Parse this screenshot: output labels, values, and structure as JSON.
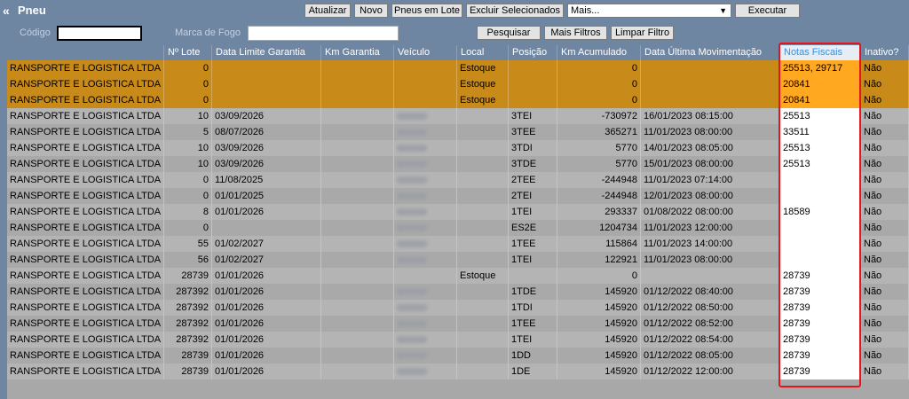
{
  "window": {
    "title": "Pneu"
  },
  "toolbar": {
    "atualizar": "Atualizar",
    "novo": "Novo",
    "pneus_em_lote": "Pneus em Lote",
    "excluir": "Excluir Selecionados",
    "mais_select": "Mais...",
    "executar": "Executar"
  },
  "filters": {
    "codigo_label": "Código",
    "codigo_value": "",
    "marca_label": "Marca de Fogo",
    "marca_value": "",
    "pesquisar": "Pesquisar",
    "mais_filtros": "Mais Filtros",
    "limpar_filtro": "Limpar Filtro"
  },
  "columns": [
    "Nº Lote",
    "Data Limite Garantia",
    "Km Garantia",
    "Veículo",
    "Local",
    "Posição",
    "Km Acumulado",
    "Data Última Movimentação",
    "Notas Fiscais",
    "Inativo?"
  ],
  "rows": [
    {
      "empresa": "RANSPORTE E LOGISTICA LTDA",
      "lote": "0",
      "data_lim": "",
      "km_gar": "",
      "veiculo": false,
      "local": "Estoque",
      "posicao": "",
      "km_acum": "0",
      "data_mov": "",
      "notas": "25513, 29717",
      "inativo": "Não",
      "selected": true
    },
    {
      "empresa": "RANSPORTE E LOGISTICA LTDA",
      "lote": "0",
      "data_lim": "",
      "km_gar": "",
      "veiculo": false,
      "local": "Estoque",
      "posicao": "",
      "km_acum": "0",
      "data_mov": "",
      "notas": "20841",
      "inativo": "Não",
      "selected": true
    },
    {
      "empresa": "RANSPORTE E LOGISTICA LTDA",
      "lote": "0",
      "data_lim": "",
      "km_gar": "",
      "veiculo": false,
      "local": "Estoque",
      "posicao": "",
      "km_acum": "0",
      "data_mov": "",
      "notas": "20841",
      "inativo": "Não",
      "selected": true
    },
    {
      "empresa": "RANSPORTE E LOGISTICA LTDA",
      "lote": "10",
      "data_lim": "03/09/2026",
      "km_gar": "",
      "veiculo": true,
      "local": "",
      "posicao": "3TEI",
      "km_acum": "-730972",
      "data_mov": "16/01/2023 08:15:00",
      "notas": "25513",
      "inativo": "Não",
      "selected": false
    },
    {
      "empresa": "RANSPORTE E LOGISTICA LTDA",
      "lote": "5",
      "data_lim": "08/07/2026",
      "km_gar": "",
      "veiculo": true,
      "local": "",
      "posicao": "3TEE",
      "km_acum": "365271",
      "data_mov": "11/01/2023 08:00:00",
      "notas": "33511",
      "inativo": "Não",
      "selected": false
    },
    {
      "empresa": "RANSPORTE E LOGISTICA LTDA",
      "lote": "10",
      "data_lim": "03/09/2026",
      "km_gar": "",
      "veiculo": true,
      "local": "",
      "posicao": "3TDI",
      "km_acum": "5770",
      "data_mov": "14/01/2023 08:05:00",
      "notas": "25513",
      "inativo": "Não",
      "selected": false
    },
    {
      "empresa": "RANSPORTE E LOGISTICA LTDA",
      "lote": "10",
      "data_lim": "03/09/2026",
      "km_gar": "",
      "veiculo": true,
      "local": "",
      "posicao": "3TDE",
      "km_acum": "5770",
      "data_mov": "15/01/2023 08:00:00",
      "notas": "25513",
      "inativo": "Não",
      "selected": false
    },
    {
      "empresa": "RANSPORTE E LOGISTICA LTDA",
      "lote": "0",
      "data_lim": "11/08/2025",
      "km_gar": "",
      "veiculo": true,
      "local": "",
      "posicao": "2TEE",
      "km_acum": "-244948",
      "data_mov": "11/01/2023 07:14:00",
      "notas": "",
      "inativo": "Não",
      "selected": false
    },
    {
      "empresa": "RANSPORTE E LOGISTICA LTDA",
      "lote": "0",
      "data_lim": "01/01/2025",
      "km_gar": "",
      "veiculo": true,
      "local": "",
      "posicao": "2TEI",
      "km_acum": "-244948",
      "data_mov": "12/01/2023 08:00:00",
      "notas": "",
      "inativo": "Não",
      "selected": false
    },
    {
      "empresa": "RANSPORTE E LOGISTICA LTDA",
      "lote": "8",
      "data_lim": "01/01/2026",
      "km_gar": "",
      "veiculo": true,
      "local": "",
      "posicao": "1TEI",
      "km_acum": "293337",
      "data_mov": "01/08/2022 08:00:00",
      "notas": "18589",
      "inativo": "Não",
      "selected": false
    },
    {
      "empresa": "RANSPORTE E LOGISTICA LTDA",
      "lote": "0",
      "data_lim": "",
      "km_gar": "",
      "veiculo": true,
      "local": "",
      "posicao": "ES2E",
      "km_acum": "1204734",
      "data_mov": "11/01/2023 12:00:00",
      "notas": "",
      "inativo": "Não",
      "selected": false
    },
    {
      "empresa": "RANSPORTE E LOGISTICA LTDA",
      "lote": "55",
      "data_lim": "01/02/2027",
      "km_gar": "",
      "veiculo": true,
      "local": "",
      "posicao": "1TEE",
      "km_acum": "115864",
      "data_mov": "11/01/2023 14:00:00",
      "notas": "",
      "inativo": "Não",
      "selected": false
    },
    {
      "empresa": "RANSPORTE E LOGISTICA LTDA",
      "lote": "56",
      "data_lim": "01/02/2027",
      "km_gar": "",
      "veiculo": true,
      "local": "",
      "posicao": "1TEI",
      "km_acum": "122921",
      "data_mov": "11/01/2023 08:00:00",
      "notas": "",
      "inativo": "Não",
      "selected": false
    },
    {
      "empresa": "RANSPORTE E LOGISTICA LTDA",
      "lote": "28739",
      "data_lim": "01/01/2026",
      "km_gar": "",
      "veiculo": false,
      "local": "Estoque",
      "posicao": "",
      "km_acum": "0",
      "data_mov": "",
      "notas": "28739",
      "inativo": "Não",
      "selected": false
    },
    {
      "empresa": "RANSPORTE E LOGISTICA LTDA",
      "lote": "287392",
      "data_lim": "01/01/2026",
      "km_gar": "",
      "veiculo": true,
      "local": "",
      "posicao": "1TDE",
      "km_acum": "145920",
      "data_mov": "01/12/2022 08:40:00",
      "notas": "28739",
      "inativo": "Não",
      "selected": false
    },
    {
      "empresa": "RANSPORTE E LOGISTICA LTDA",
      "lote": "287392",
      "data_lim": "01/01/2026",
      "km_gar": "",
      "veiculo": true,
      "local": "",
      "posicao": "1TDI",
      "km_acum": "145920",
      "data_mov": "01/12/2022 08:50:00",
      "notas": "28739",
      "inativo": "Não",
      "selected": false
    },
    {
      "empresa": "RANSPORTE E LOGISTICA LTDA",
      "lote": "287392",
      "data_lim": "01/01/2026",
      "km_gar": "",
      "veiculo": true,
      "local": "",
      "posicao": "1TEE",
      "km_acum": "145920",
      "data_mov": "01/12/2022 08:52:00",
      "notas": "28739",
      "inativo": "Não",
      "selected": false
    },
    {
      "empresa": "RANSPORTE E LOGISTICA LTDA",
      "lote": "287392",
      "data_lim": "01/01/2026",
      "km_gar": "",
      "veiculo": true,
      "local": "",
      "posicao": "1TEI",
      "km_acum": "145920",
      "data_mov": "01/12/2022 08:54:00",
      "notas": "28739",
      "inativo": "Não",
      "selected": false
    },
    {
      "empresa": "RANSPORTE E LOGISTICA LTDA",
      "lote": "28739",
      "data_lim": "01/01/2026",
      "km_gar": "",
      "veiculo": true,
      "local": "",
      "posicao": "1DD",
      "km_acum": "145920",
      "data_mov": "01/12/2022 08:05:00",
      "notas": "28739",
      "inativo": "Não",
      "selected": false
    },
    {
      "empresa": "RANSPORTE E LOGISTICA LTDA",
      "lote": "28739",
      "data_lim": "01/01/2026",
      "km_gar": "",
      "veiculo": true,
      "local": "",
      "posicao": "1DE",
      "km_acum": "145920",
      "data_mov": "01/12/2022 12:00:00",
      "notas": "28739",
      "inativo": "Não",
      "selected": false
    }
  ],
  "colors": {
    "header": "#6f86a3",
    "selected_row": "#c88a18",
    "notas_highlight": "#ffa820",
    "annotation_box": "#e8121d"
  }
}
